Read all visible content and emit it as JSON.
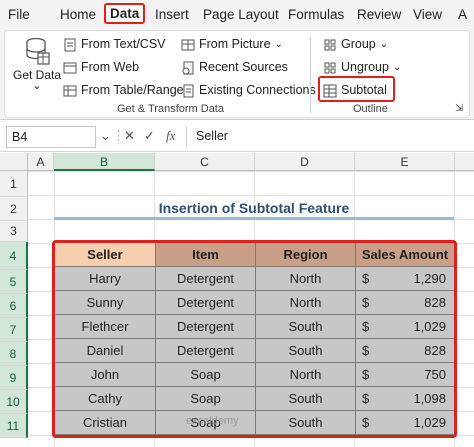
{
  "tabs": [
    "File",
    "Home",
    "Data",
    "Insert",
    "Page Layout",
    "Formulas",
    "Review",
    "View",
    "A"
  ],
  "ribbon": {
    "get_data": "Get Data",
    "get_data_arrow": "⌄",
    "from_text_csv": "From Text/CSV",
    "from_web": "From Web",
    "from_table_range": "From Table/Range",
    "from_picture": "From Picture",
    "recent_sources": "Recent Sources",
    "existing_connections": "Existing Connections",
    "group_label_get_transform": "Get & Transform Data",
    "group": "Group",
    "ungroup": "Ungroup",
    "subtotal": "Subtotal",
    "group_label_outline": "Outline"
  },
  "formula_bar": {
    "name_box": "B4",
    "fx": "fx",
    "value": "Seller"
  },
  "columns": [
    "A",
    "B",
    "C",
    "D",
    "E"
  ],
  "rows": [
    "1",
    "2",
    "3",
    "4",
    "5",
    "6",
    "7",
    "8",
    "9",
    "10",
    "11"
  ],
  "sheet_title": "Insertion of Subtotal Feature",
  "table": {
    "headers": [
      "Seller",
      "Item",
      "Region",
      "Sales Amount"
    ],
    "currency": "$",
    "rows": [
      {
        "seller": "Harry",
        "item": "Detergent",
        "region": "North",
        "amount": "1,290"
      },
      {
        "seller": "Sunny",
        "item": "Detergent",
        "region": "North",
        "amount": "828"
      },
      {
        "seller": "Flethcer",
        "item": "Detergent",
        "region": "South",
        "amount": "1,029"
      },
      {
        "seller": "Daniel",
        "item": "Detergent",
        "region": "South",
        "amount": "828"
      },
      {
        "seller": "John",
        "item": "Soap",
        "region": "North",
        "amount": "750"
      },
      {
        "seller": "Cathy",
        "item": "Soap",
        "region": "South",
        "amount": "1,098"
      },
      {
        "seller": "Cristian",
        "item": "Soap",
        "region": "South",
        "amount": "1,029"
      }
    ]
  },
  "watermark": "exceldemy",
  "colors": {
    "accent_red": "#e0201b",
    "excel_green": "#1e7145"
  }
}
